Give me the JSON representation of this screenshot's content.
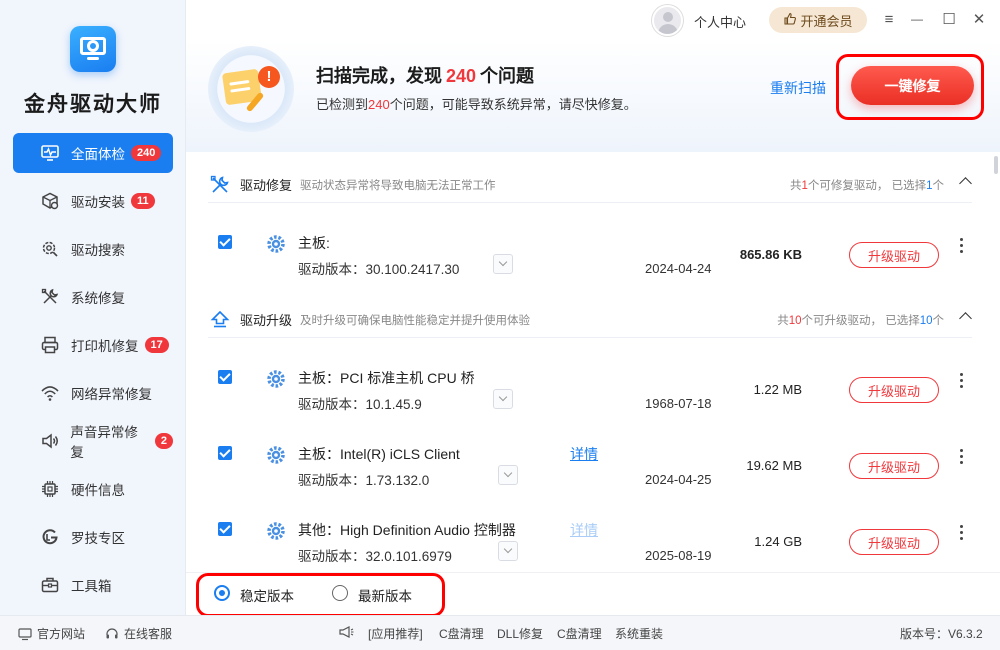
{
  "app": {
    "name": "金舟驱动大师"
  },
  "titlebar": {
    "user_center": "个人中心",
    "vip_label": "开通会员",
    "vip_icon": "thumbs-up-icon",
    "menu_icon": "≡",
    "min_icon": "—",
    "max_icon": "☐",
    "close_icon": "✕"
  },
  "sidebar": {
    "items": [
      {
        "label": "全面体检",
        "badge": "240",
        "icon": "monitor-pulse-icon",
        "active": true
      },
      {
        "label": "驱动安装",
        "badge": "11",
        "icon": "box-gear-icon"
      },
      {
        "label": "驱动搜索",
        "badge": "",
        "icon": "gear-search-icon"
      },
      {
        "label": "系统修复",
        "badge": "",
        "icon": "wrench-icon"
      },
      {
        "label": "打印机修复",
        "badge": "17",
        "icon": "printer-icon"
      },
      {
        "label": "网络异常修复",
        "badge": "",
        "icon": "wifi-icon"
      },
      {
        "label": "声音异常修复",
        "badge": "2",
        "icon": "speaker-icon"
      },
      {
        "label": "硬件信息",
        "badge": "",
        "icon": "chip-icon"
      },
      {
        "label": "罗技专区",
        "badge": "",
        "icon": "logitech-icon"
      },
      {
        "label": "工具箱",
        "badge": "",
        "icon": "toolbox-icon"
      }
    ]
  },
  "banner": {
    "title_prefix": "扫描完成，发现",
    "title_count": "240",
    "title_suffix": "个问题",
    "sub_prefix": "已检测到",
    "sub_count": "240",
    "sub_suffix": "个问题，可能导致系统异常，请尽快修复。",
    "rescan_label": "重新扫描",
    "repair_label": "一键修复"
  },
  "sections": [
    {
      "title": "驱动修复",
      "desc": "驱动状态异常将导致电脑无法正常工作",
      "stat_prefix": "共",
      "stat_total": "1",
      "stat_mid": "个可修复驱动，  已选择",
      "stat_selected": "1",
      "stat_suffix": "个",
      "rows": [
        {
          "name": "主板:",
          "version_label": "驱动版本：",
          "version": "30.100.2417.30",
          "detail": "",
          "date": "2024-04-24",
          "size": "865.86 KB",
          "button": "升级驱动"
        }
      ]
    },
    {
      "title": "驱动升级",
      "desc": "及时升级可确保电脑性能稳定并提升使用体验",
      "stat_prefix": "共",
      "stat_total": "10",
      "stat_mid": "个可升级驱动，  已选择",
      "stat_selected": "10",
      "stat_suffix": "个",
      "rows": [
        {
          "name": "主板：PCI 标准主机 CPU 桥",
          "version_label": "驱动版本：",
          "version": "10.1.45.9",
          "detail": "",
          "date": "1968-07-18",
          "size": "1.22 MB",
          "button": "升级驱动"
        },
        {
          "name": "主板：Intel(R) iCLS Client",
          "version_label": "驱动版本：",
          "version": "1.73.132.0",
          "detail": "详情",
          "date": "2024-04-25",
          "size": "19.62 MB",
          "button": "升级驱动"
        },
        {
          "name": "其他：High Definition Audio 控制器",
          "version_label": "驱动版本：",
          "version": "32.0.101.6979",
          "detail": "详情",
          "date": "2025-08-19",
          "size": "1.24 GB",
          "button": "升级驱动"
        }
      ]
    }
  ],
  "options": {
    "stable_label": "稳定版本",
    "latest_label": "最新版本",
    "selected": "stable"
  },
  "statusbar": {
    "website": "官方网站",
    "support": "在线客服",
    "recommend": "[应用推荐]",
    "links": [
      "C盘清理",
      "DLL修复",
      "C盘清理",
      "系统重装"
    ],
    "version": "版本号：V6.3.2"
  }
}
